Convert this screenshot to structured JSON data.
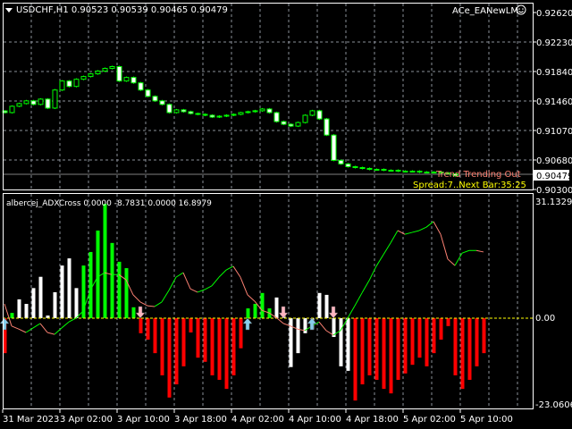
{
  "header": {
    "symbol_info": "USDCHF,H1  0.90523 0.90539 0.90465 0.90479",
    "expert_name": "ACe_EANewLM",
    "expert_icon": "smiley-icon"
  },
  "overlay": {
    "trend_text": "Trend Trending Out",
    "spread_text": "Spread:7..Next Bar:35:25"
  },
  "colors": {
    "bull_candle": "#00ff00",
    "bear_fill": "#ffffff",
    "hist_green": "#00ff00",
    "hist_red": "#ff0000",
    "hist_white": "#ffffff",
    "line_up": "#00ff00",
    "line_down": "#fa8072",
    "zero_line": "#ffff00",
    "arrow_up": "#87ceeb",
    "arrow_down": "#ffb6c1",
    "trend_text": "#fa8072",
    "spread_text": "#ffff00"
  },
  "price_axis": {
    "labels": [
      "0.92620",
      "0.92230",
      "0.91840",
      "0.91460",
      "0.91070",
      "0.90680",
      "0.90300"
    ],
    "current_price": "0.90479"
  },
  "indicator": {
    "label": "albercej_ADXCross 0.0000 -8.7831 0.0000 16.8979",
    "axis_labels": [
      "31.1329",
      "0.00",
      "-23.0606"
    ]
  },
  "time_axis": {
    "labels": [
      "31 Mar 2023",
      "3 Apr 02:00",
      "3 Apr 10:00",
      "3 Apr 18:00",
      "4 Apr 02:00",
      "4 Apr 10:00",
      "4 Apr 18:00",
      "5 Apr 02:00",
      "5 Apr 10:00"
    ]
  },
  "chart_data": {
    "type": "candlestick",
    "first_open": 0.9133,
    "closes": [
      0.91308,
      0.91391,
      0.91426,
      0.91462,
      0.91415,
      0.91485,
      0.91367,
      0.91604,
      0.91722,
      0.91651,
      0.91745,
      0.91781,
      0.91816,
      0.91852,
      0.91887,
      0.91911,
      0.91722,
      0.91769,
      0.91698,
      0.91604,
      0.91521,
      0.91462,
      0.91415,
      0.91308,
      0.91344,
      0.9132,
      0.91296,
      0.91285,
      0.91273,
      0.91249,
      0.91261,
      0.91273,
      0.91285,
      0.91308,
      0.9132,
      0.91332,
      0.91355,
      0.91308,
      0.9119,
      0.91155,
      0.91131,
      0.91178,
      0.91273,
      0.91332,
      0.91225,
      0.91013,
      0.90682,
      0.90635,
      0.90599,
      0.90587,
      0.90576,
      0.90564,
      0.90564,
      0.90552,
      0.90552,
      0.9054,
      0.9054,
      0.9054,
      0.90528,
      0.90528,
      0.90528,
      0.90516,
      0.90505,
      0.90479
    ],
    "price_range": [
      0.903,
      0.9262
    ],
    "indicator_range": [
      -23.0606,
      31.1329
    ],
    "histogram": [
      [
        -9.3,
        "red"
      ],
      [
        1.4,
        "green"
      ],
      [
        5,
        "white"
      ],
      [
        3.8,
        "white"
      ],
      [
        8,
        "white"
      ],
      [
        11,
        "white"
      ],
      [
        0.7,
        "white"
      ],
      [
        6.9,
        "white"
      ],
      [
        14,
        "white"
      ],
      [
        15.9,
        "white"
      ],
      [
        8,
        "white"
      ],
      [
        14,
        "green"
      ],
      [
        17.6,
        "green"
      ],
      [
        23.3,
        "green"
      ],
      [
        30.4,
        "green"
      ],
      [
        20,
        "green"
      ],
      [
        15,
        "green"
      ],
      [
        13.3,
        "green"
      ],
      [
        2.9,
        "green"
      ],
      [
        -4,
        "red"
      ],
      [
        -5.7,
        "red"
      ],
      [
        -9.3,
        "red"
      ],
      [
        -15.2,
        "red"
      ],
      [
        -21.1,
        "red"
      ],
      [
        -17.6,
        "red"
      ],
      [
        -12.8,
        "red"
      ],
      [
        -3.8,
        "red"
      ],
      [
        -10.5,
        "red"
      ],
      [
        -11.6,
        "red"
      ],
      [
        -15.2,
        "red"
      ],
      [
        -16.4,
        "red"
      ],
      [
        -18.8,
        "red"
      ],
      [
        -15.2,
        "red"
      ],
      [
        -8,
        "red"
      ],
      [
        2.6,
        "green"
      ],
      [
        3.8,
        "green"
      ],
      [
        6.7,
        "green"
      ],
      [
        2.6,
        "green"
      ],
      [
        5.5,
        "white"
      ],
      [
        1.4,
        "white"
      ],
      [
        -13,
        "white"
      ],
      [
        -9.3,
        "white"
      ],
      [
        -4,
        "white"
      ],
      [
        -3,
        "white"
      ],
      [
        6.7,
        "white"
      ],
      [
        6.2,
        "white"
      ],
      [
        -5,
        "white"
      ],
      [
        -12.8,
        "white"
      ],
      [
        -14,
        "white"
      ],
      [
        -21.9,
        "red"
      ],
      [
        -17.6,
        "red"
      ],
      [
        -15.2,
        "red"
      ],
      [
        -16.4,
        "red"
      ],
      [
        -18.8,
        "red"
      ],
      [
        -20,
        "red"
      ],
      [
        -16.4,
        "red"
      ],
      [
        -14.7,
        "red"
      ],
      [
        -12.4,
        "red"
      ],
      [
        -10.5,
        "red"
      ],
      [
        -12.8,
        "red"
      ],
      [
        -9.3,
        "red"
      ],
      [
        -5.7,
        "red"
      ],
      [
        -2.1,
        "red"
      ],
      [
        -15.2,
        "red"
      ],
      [
        -18.8,
        "red"
      ],
      [
        -16.4,
        "red"
      ],
      [
        -12.8,
        "red"
      ],
      [
        -9.3,
        "red"
      ]
    ],
    "adx_line": [
      3.8,
      -2.1,
      -2.9,
      -3.8,
      -2.6,
      -1.4,
      -3.8,
      -4.3,
      -2.6,
      -1,
      0,
      1.9,
      7.4,
      10.9,
      12.1,
      11.6,
      11.6,
      10.2,
      6.2,
      4.3,
      3.3,
      3.1,
      4.3,
      7.4,
      10.9,
      12.1,
      7.8,
      6.9,
      7.6,
      8.6,
      10.9,
      12.8,
      13.8,
      10.9,
      6.2,
      4.5,
      2.1,
      1.4,
      0.2,
      -1.4,
      -2.1,
      -2.9,
      -3.3,
      -2.1,
      -1,
      -3.3,
      -4.5,
      -3.3,
      0,
      3.3,
      6.7,
      10,
      13.8,
      16.9,
      20,
      23.3,
      22.3,
      22.8,
      23.3,
      24.2,
      25.7,
      22.3,
      15.7,
      14,
      17.3,
      18,
      18,
      17.6
    ],
    "up_arrow_bars": [
      0,
      34,
      43
    ],
    "down_arrow_bars": [
      19,
      39,
      46
    ]
  }
}
